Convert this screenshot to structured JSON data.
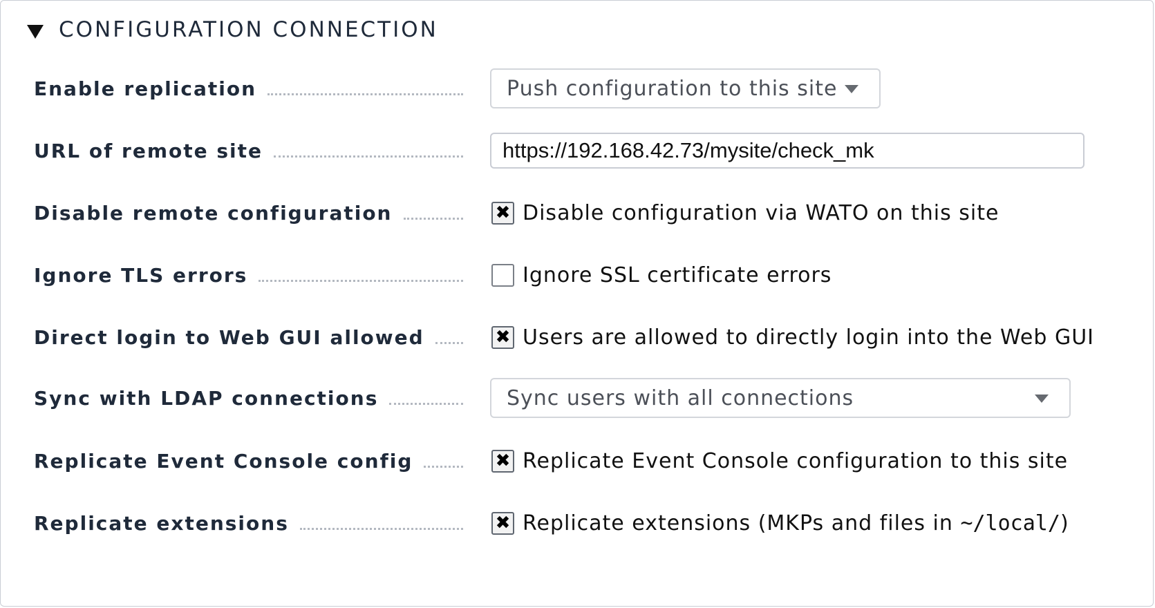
{
  "section": {
    "title": "CONFIGURATION CONNECTION",
    "toggle_icon": "triangle-down-icon"
  },
  "rows": {
    "enable_replication": {
      "label": "Enable replication",
      "value": "Push configuration to this site"
    },
    "url_remote_site": {
      "label": "URL of remote site",
      "value": "https://192.168.42.73/mysite/check_mk"
    },
    "disable_remote_config": {
      "label": "Disable remote configuration",
      "checked": true,
      "text": "Disable configuration via WATO on this site"
    },
    "ignore_tls": {
      "label": "Ignore TLS errors",
      "checked": false,
      "text": "Ignore SSL certificate errors"
    },
    "direct_login": {
      "label": "Direct login to Web GUI allowed",
      "checked": true,
      "text": "Users are allowed to directly login into the Web GUI"
    },
    "sync_ldap": {
      "label": "Sync with LDAP connections",
      "value": "Sync users with all connections"
    },
    "replicate_ec": {
      "label": "Replicate Event Console config",
      "checked": true,
      "text": "Replicate Event Console configuration to this site"
    },
    "replicate_ext": {
      "label": "Replicate extensions",
      "checked": true,
      "text_before": "Replicate extensions (MKPs and files in ",
      "text_code": "~/local/",
      "text_after": ")"
    }
  },
  "check_glyph": "✖",
  "colors": {
    "label_text": "#1f2a3a",
    "border": "#c9cdd4",
    "dots": "#b3b8c0"
  }
}
